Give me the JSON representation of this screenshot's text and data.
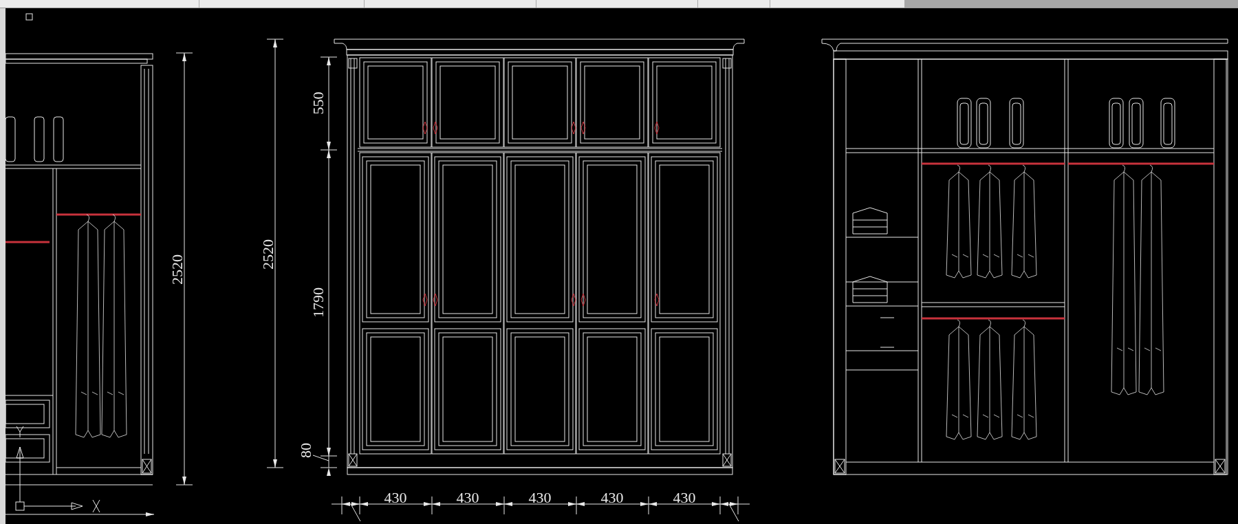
{
  "drawing": {
    "overall_heights": [
      "2520",
      "2520"
    ],
    "section_heights": [
      "550",
      "1790",
      "80"
    ],
    "door_widths": [
      "430",
      "430",
      "430",
      "430",
      "430"
    ]
  }
}
